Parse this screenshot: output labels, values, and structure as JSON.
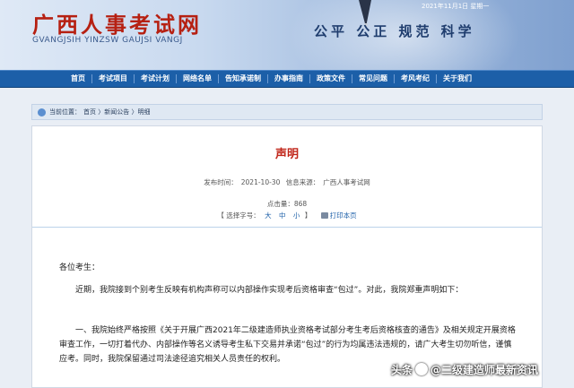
{
  "header": {
    "site_title": "广西人事考试网",
    "site_subtitle": "GVANGJSIH YINZSW GAUJSI VANGJ",
    "date": "2021年11月1日  星期一",
    "slogan": "公平 公正 规范 科学"
  },
  "nav": {
    "items": [
      "首页",
      "考试项目",
      "考试计划",
      "网络名单",
      "告知承诺制",
      "办事指南",
      "政策文件",
      "常见问题",
      "考风考纪",
      "关于我们"
    ]
  },
  "breadcrumb": {
    "label": "当前位置：",
    "path": "首页 〉新闻公告 〉明细"
  },
  "article": {
    "title": "声明",
    "published_label": "发布时间：",
    "published": "2021-10-30",
    "source_label": "信息来源：",
    "source": "广西人事考试网",
    "hits_label": "点击量：",
    "hits": "868",
    "font_size_label": "【 选择字号：",
    "size_large": "大",
    "size_medium": "中",
    "size_small": "小",
    "close_bracket": "】",
    "print_label": "打印本页",
    "greeting": "各位考生：",
    "paragraph1": "近期，我院接到个别考生反映有机构声称可以内部操作实现考后资格审查“包过”。对此，我院郑重声明如下：",
    "paragraph2": "一、我院始终严格按照《关于开展广西2021年二级建造师执业资格考试部分考生考后资格核查的通告》及相关规定开展资格审查工作，一切打着代办、内部操作等名义诱导考生私下交易并承诺“包过”的行为均属违法违规的，请广大考生切勿听信，谨慎应考。同时，我院保留通过司法途径追究相关人员责任的权利。"
  },
  "watermark": {
    "prefix": "头条",
    "handle": "@二级建造师最新资讯"
  },
  "colors": {
    "nav_bg": "#1c5fa8",
    "title_red": "#c0261a",
    "site_title_red": "#b62012"
  }
}
